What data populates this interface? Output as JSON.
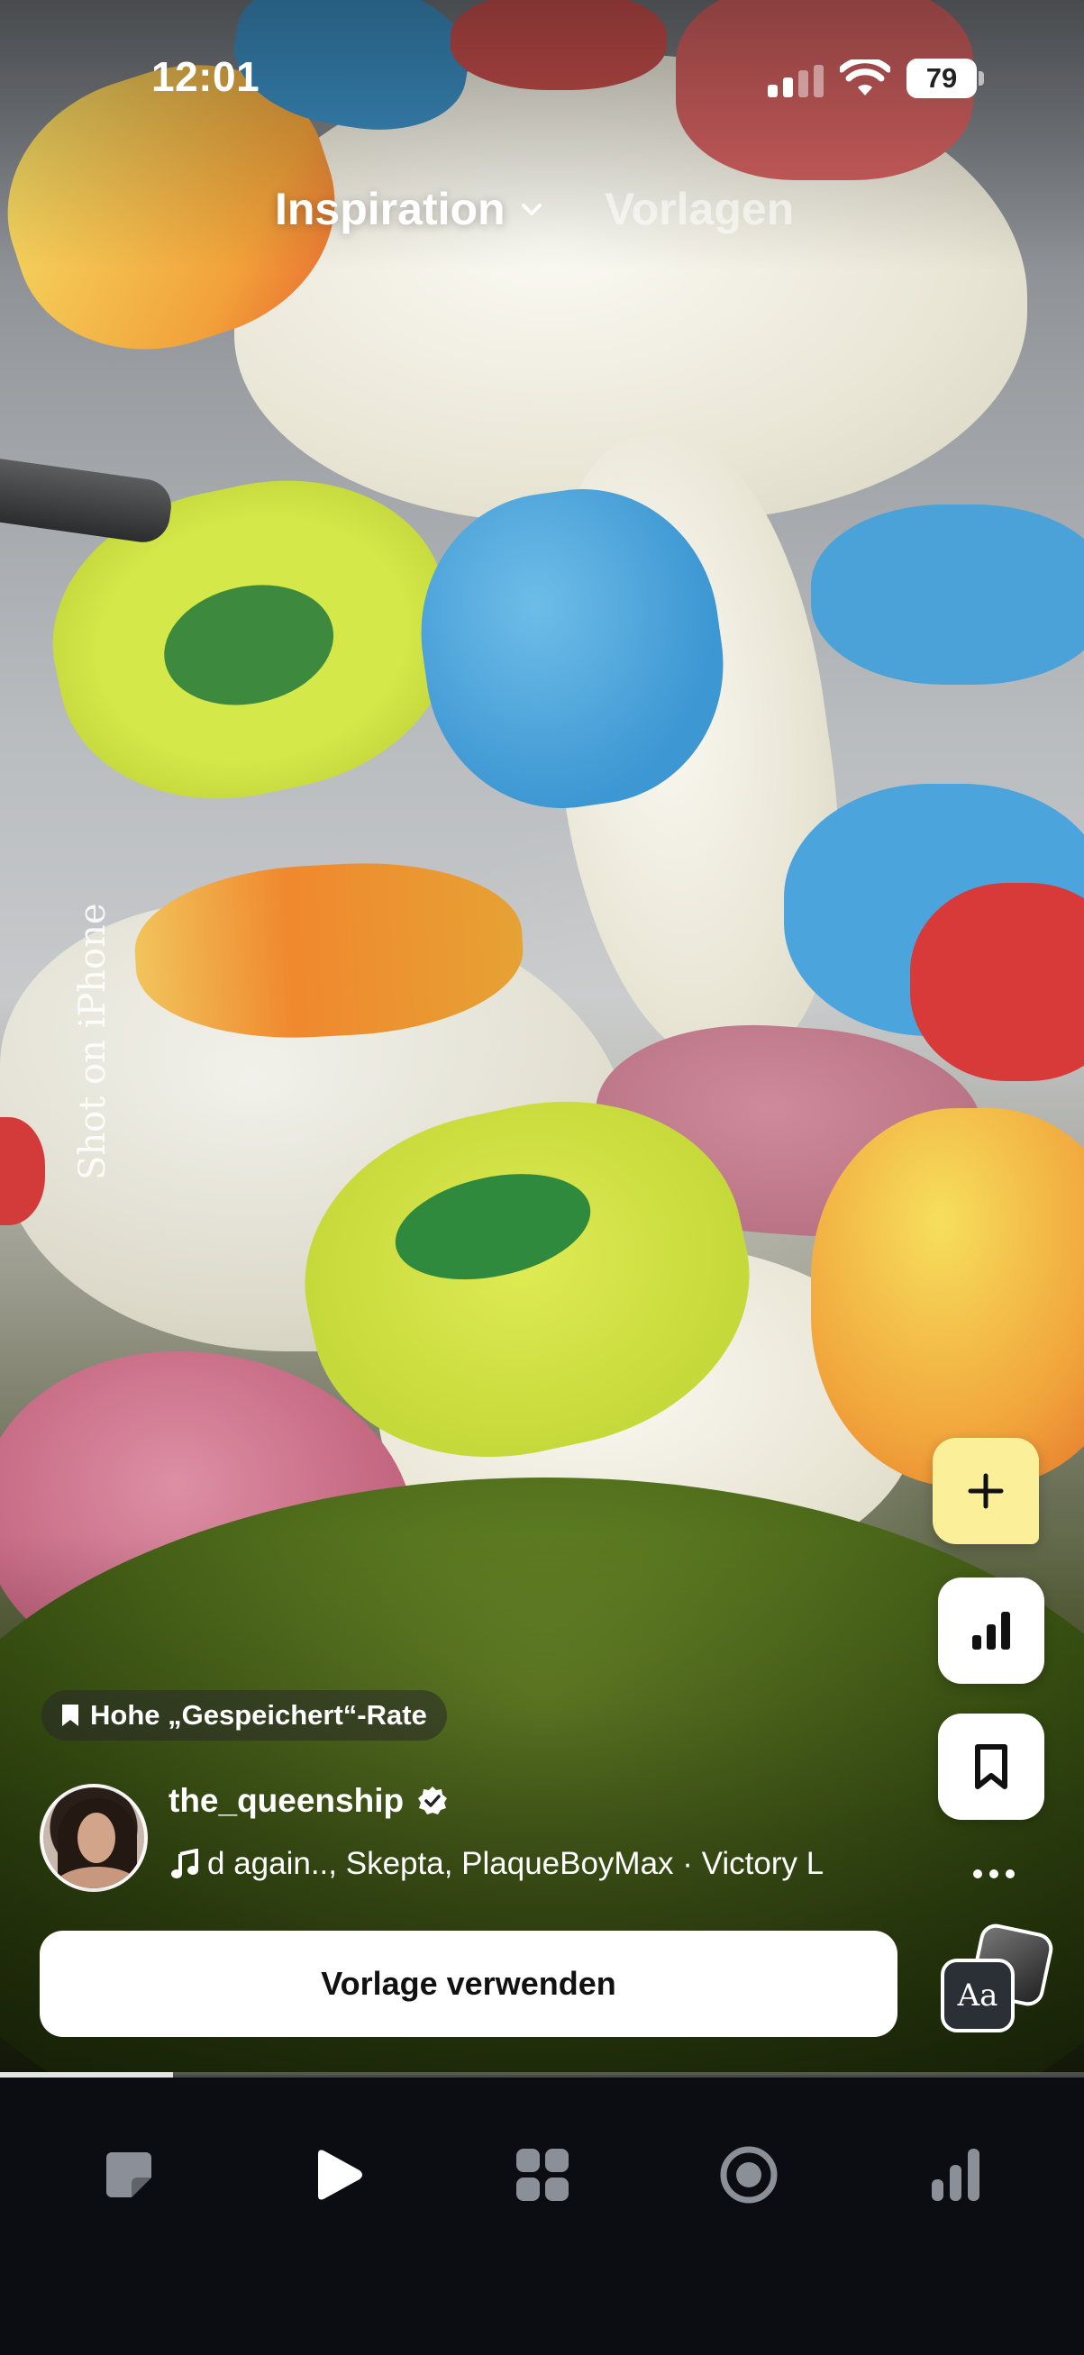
{
  "status_bar": {
    "time": "12:01",
    "battery": "79"
  },
  "tabs": {
    "active": "Inspiration",
    "other": "Vorlagen"
  },
  "media": {
    "watermark": "Shot on iPhone"
  },
  "post": {
    "badge": "Hohe „Gespeichert“-Rate",
    "username": "the_queenship",
    "music": "d again.., Skepta, PlaqueBoyMax · Victory L"
  },
  "actions": {
    "use_template": "Vorlage verwenden",
    "text_style_label": "Aa"
  },
  "rail_icons": [
    "plus-icon",
    "stats-icon",
    "bookmark-icon",
    "more-icon"
  ],
  "bottom_nav": [
    "drafts-icon",
    "play-icon",
    "grid-icon",
    "record-icon",
    "stats-icon"
  ],
  "playback_progress": 0.16,
  "colors": {
    "create_button": "#fcef9a",
    "nav_background": "#0b0d12",
    "primary_button": "#ffffff"
  }
}
